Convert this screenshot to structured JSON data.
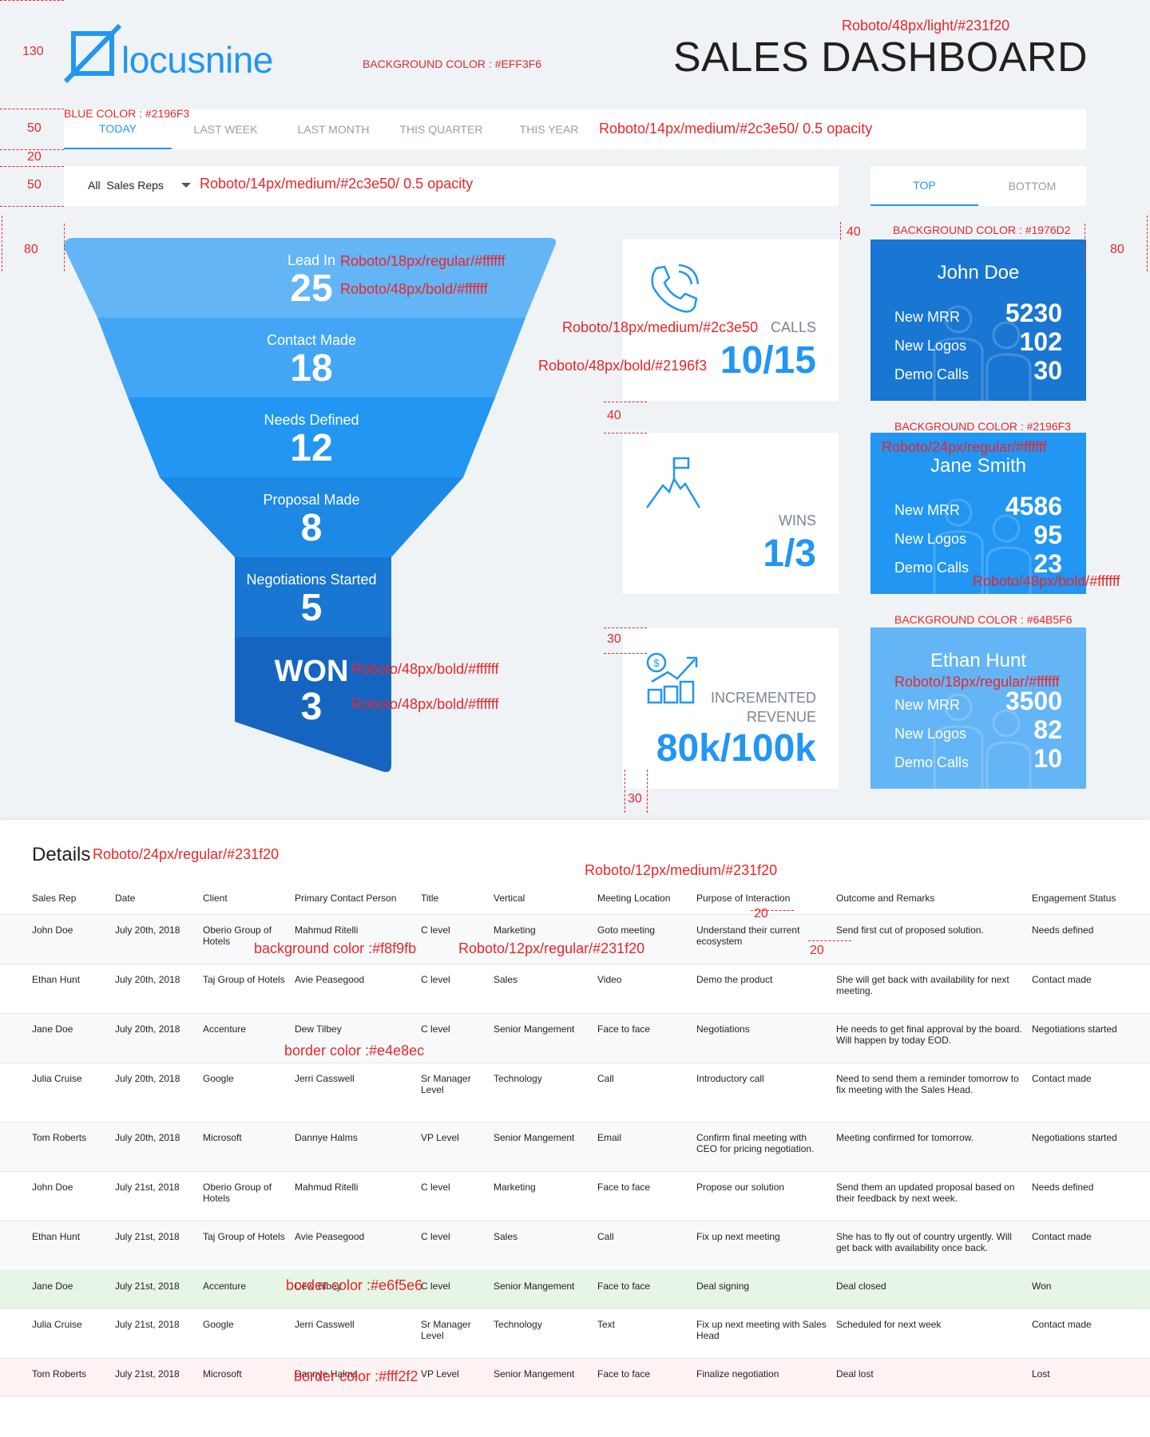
{
  "header": {
    "logo_text": "locusnine",
    "title": "SALES DASHBOARD"
  },
  "tabs": [
    "TODAY",
    "LAST WEEK",
    "LAST MONTH",
    "THIS QUARTER",
    "THIS YEAR"
  ],
  "filter": {
    "selected": "All  Sales Reps"
  },
  "topbottom": [
    "TOP",
    "BOTTOM"
  ],
  "funnel": [
    {
      "label": "Lead In",
      "value": "25"
    },
    {
      "label": "Contact Made",
      "value": "18"
    },
    {
      "label": "Needs Defined",
      "value": "12"
    },
    {
      "label": "Proposal Made",
      "value": "8"
    },
    {
      "label": "Negotiations Started",
      "value": "5"
    },
    {
      "label": "WON",
      "value": "3"
    }
  ],
  "stats": {
    "calls": {
      "title": "CALLS",
      "value": "10/15"
    },
    "wins": {
      "title": "WINS",
      "value": "1/3"
    },
    "revenue": {
      "title1": "INCREMENTED",
      "title2": "REVENUE",
      "value": "80k/100k"
    }
  },
  "reps": [
    {
      "name": "John Doe",
      "color": "#1976D2",
      "mrr": "5230",
      "logos": "102",
      "demo": "30"
    },
    {
      "name": "Jane Smith",
      "color": "#2196F3",
      "mrr": "4586",
      "logos": "95",
      "demo": "23"
    },
    {
      "name": "Ethan Hunt",
      "color": "#64B5F6",
      "mrr": "3500",
      "logos": "82",
      "demo": "10"
    }
  ],
  "rep_labels": {
    "mrr": "New MRR",
    "logos": "New Logos",
    "demo": "Demo Calls"
  },
  "details": {
    "title": "Details",
    "columns": [
      "Sales Rep",
      "Date",
      "Client",
      "Primary Contact Person",
      "Title",
      "Vertical",
      "Meeting Location",
      "Purpose of Interaction",
      "Outcome and Remarks",
      "Engagement Status"
    ],
    "rows": [
      [
        "John Doe",
        "July 20th, 2018",
        "Oberio Group of Hotels",
        "Mahmud Ritelli",
        "C level",
        "Marketing",
        "Goto meeting",
        "Understand their current ecosystem",
        "Send first cut of proposed solution.",
        "Needs defined"
      ],
      [
        "Ethan Hunt",
        "July 20th, 2018",
        "Taj Group of Hotels",
        "Avie Peasegood",
        "C level",
        "Sales",
        "Video",
        "Demo the product",
        "She will get back with availability for next meeting.",
        "Contact made"
      ],
      [
        "Jane Doe",
        "July 20th, 2018",
        "Accenture",
        "Dew Tilbey",
        "C level",
        "Senior Mangement",
        "Face to face",
        "Negotiations",
        "He needs to get final approval by the board. Will happen by today EOD.",
        "Negotiations started"
      ],
      [
        "Julia Cruise",
        "July 20th, 2018",
        "Google",
        "Jerri Casswell",
        "Sr Manager Level",
        "Technology",
        "Call",
        "Introductory call",
        "Need to send them a reminder tomorrow to fix meeting with the Sales Head.",
        "Contact made"
      ],
      [
        "Tom Roberts",
        "July 20th, 2018",
        "Microsoft",
        "Dannye Halms",
        "VP Level",
        "Senior Mangement",
        "Email",
        "Confirm final meeting with CEO for pricing negotiation.",
        "Meeting confirmed for tomorrow.",
        "Negotiations started"
      ],
      [
        "John Doe",
        "July 21st, 2018",
        "Oberio Group of Hotels",
        "Mahmud Ritelli",
        "C level",
        "Marketing",
        "Face to face",
        "Propose our solution",
        "Send them an updated proposal based on their feedback by next week.",
        "Needs defined"
      ],
      [
        "Ethan Hunt",
        "July 21st, 2018",
        "Taj Group of Hotels",
        "Avie Peasegood",
        "C level",
        "Sales",
        "Call",
        "Fix up next meeting",
        "She has to fly out of country urgently. Will get back with availability once back.",
        "Contact made"
      ],
      [
        "Jane Doe",
        "July 21st, 2018",
        "Accenture",
        "Dew Tilbey",
        "C level",
        "Senior Mangement",
        "Face to face",
        "Deal signing",
        "Deal closed",
        "Won"
      ],
      [
        "Julia Cruise",
        "July 21st, 2018",
        "Google",
        "Jerri Casswell",
        "Sr Manager Level",
        "Technology",
        "Text",
        "Fix up next meeting with Sales Head",
        "Scheduled for next week",
        "Contact made"
      ],
      [
        "Tom Roberts",
        "July 21st, 2018",
        "Microsoft",
        "Dannye Halms",
        "VP Level",
        "Senior Mangement",
        "Face to face",
        "Finalize negotiation",
        "Deal lost",
        "Lost"
      ]
    ],
    "row_styles": [
      "alt",
      "",
      "alt",
      "",
      "alt",
      "",
      "alt",
      "won",
      "",
      "lost"
    ]
  },
  "annotations": {
    "a130": "130",
    "a50a": "50",
    "a20": "20",
    "a50b": "50",
    "a80l": "80",
    "a80r": "80",
    "a40a": "40",
    "a40b": "40",
    "a30a": "30",
    "a30b": "30",
    "a20b": "20",
    "a20c": "20",
    "bg": "BACKGROUND COLOR : #EFF3F6",
    "blue": "BLUE COLOR : #2196F3",
    "titlefont": "Roboto/48px/light/#231f20",
    "tabfont": "Roboto/14px/medium/#2c3e50/ 0.5 opacity",
    "filterfont": "Roboto/14px/medium/#2c3e50/ 0.5 opacity",
    "leadfont": "Roboto/18px/regular/#ffffff",
    "numfont": "Roboto/48px/bold/#ffffff",
    "wonfont1": "Roboto/48px/bold/#ffffff",
    "wonfont2": "Roboto/48px/bold/#ffffff",
    "callsfont": "Roboto/18px/medium/#2c3e50",
    "callsval": "Roboto/48px/bold/#2196f3",
    "rep1bg": "BACKGROUND COLOR : #1976D2",
    "rep2bg": "BACKGROUND COLOR : #2196F3",
    "rep2name": "Roboto/24px/regular/#ffffff",
    "rep2val": "Roboto/48px/bold/#ffffff",
    "rep3bg": "BACKGROUND COLOR : #64B5F6",
    "rep3lbl": "Roboto/18px/regular/#ffffff",
    "detailsfont": "Roboto/24px/regular/#231f20",
    "thfont": "Roboto/12px/medium/#231f20",
    "rowbg": "background color :#f8f9fb",
    "tdfont": "Roboto/12px/regular/#231f20",
    "border": "border color :#e4e8ec",
    "wonborder": "border color :#e6f5e6",
    "lostborder": "border color :#fff2f2"
  }
}
